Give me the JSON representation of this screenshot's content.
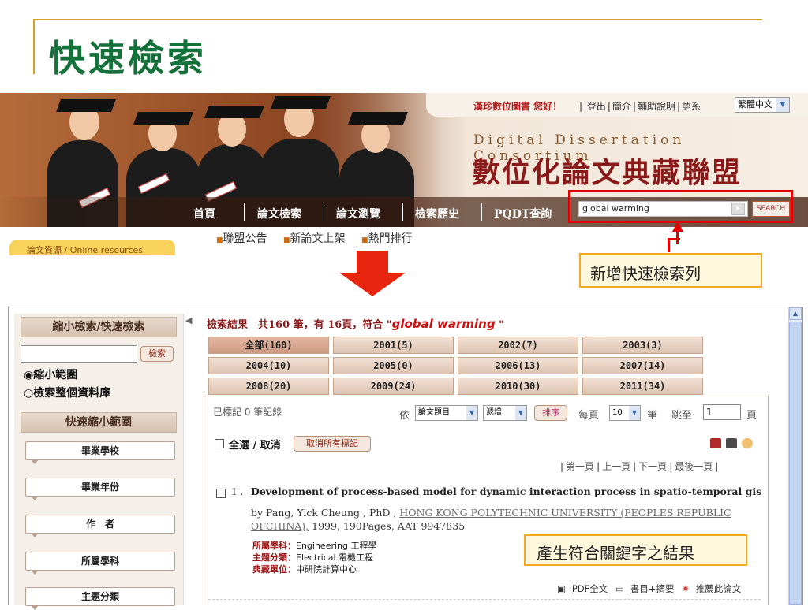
{
  "slide": {
    "title": "快速檢索"
  },
  "banner": {
    "greeting": "漢珍數位圖書 您好！",
    "top_links": [
      "登出",
      "簡介",
      "輔助說明",
      "語系"
    ],
    "language": "繁體中文",
    "brand_en": "Digital Dissertation Consortium",
    "brand_zh": "數位化論文典藏聯盟",
    "nav": [
      "首頁",
      "論文檢索",
      "論文瀏覽",
      "檢索歷史",
      "PQDT查詢"
    ],
    "search_value": "global warming",
    "search_button": "SEARCH",
    "sub_links": [
      "聯盟公告",
      "新論文上架",
      "熱門排行"
    ],
    "resource_tab": "論文資源 / Online resources"
  },
  "callouts": {
    "new_search_bar": "新增快速檢索列",
    "results_note": "產生符合關鍵字之結果"
  },
  "left_panel": {
    "header": "縮小檢索/快速檢索",
    "search_button": "檢索",
    "radio_narrow": "縮小範圍",
    "radio_full": "檢索整個資料庫",
    "quick_header": "快速縮小範圍",
    "facets": [
      "畢業學校",
      "畢業年份",
      "作　者",
      "所屬學科",
      "主題分類"
    ]
  },
  "results": {
    "summary_prefix": "檢索結果　共160 筆，有 16頁，",
    "summary_match": "符合 \"",
    "keyword": "global warming",
    "summary_suffix": " \"",
    "year_tabs": [
      "全部(160)",
      "2001(5)",
      "2002(7)",
      "2003(3)",
      "2004(10)",
      "2005(0)",
      "2006(13)",
      "2007(14)",
      "2008(20)",
      "2009(24)",
      "2010(30)",
      "2011(34)"
    ],
    "active_tab": "全部(160)",
    "marked_label": "已標記 0 筆記錄",
    "sort_by_label": "依",
    "sort_field": "論文題目",
    "sort_order": "遞增",
    "sort_button": "排序",
    "per_page_label": "每頁",
    "per_page_value": "10",
    "per_page_unit": "筆",
    "jump_label": "跳至",
    "jump_value": "1",
    "jump_unit": "頁",
    "select_all": "全選 / 取消",
    "clear_marks": "取消所有標記",
    "pager": [
      "第一頁",
      "上一頁",
      "下一頁",
      "最後一頁"
    ],
    "record": {
      "number": "1 .",
      "title": "Development of process-based model for dynamic interaction process in spatio-temporal gis",
      "by_prefix": "by Pang, Yick Cheung , PhD , ",
      "institution": "HONG KONG POLYTECHNIC UNIVERSITY (PEOPLES REPUBLIC OFCHINA),",
      "details": " 1999, 190Pages, AAT 9947835",
      "meta": [
        {
          "label": "所屬學科：",
          "value": "Engineering 工程學"
        },
        {
          "label": "主題分類：",
          "value": "Electrical 電機工程"
        },
        {
          "label": "典藏單位：",
          "value": "中研院計算中心"
        }
      ],
      "links": [
        "PDF全文",
        "書目+摘要",
        "推薦此論文"
      ]
    }
  }
}
